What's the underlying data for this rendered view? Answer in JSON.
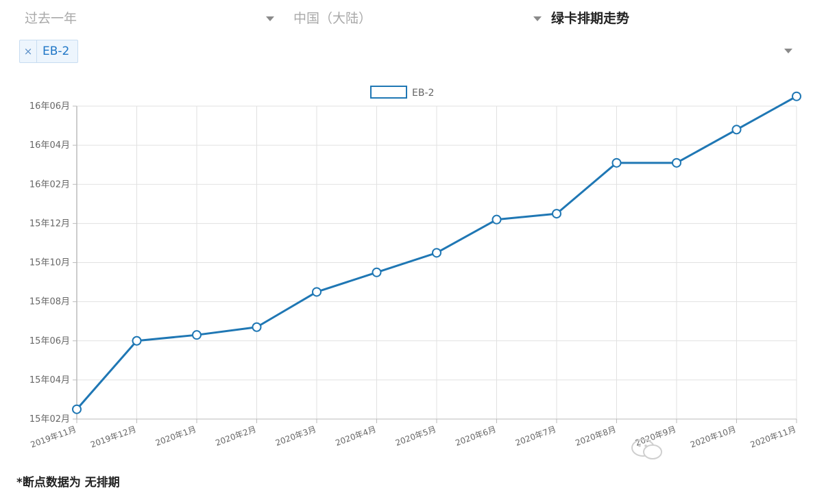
{
  "filters": {
    "time_range": {
      "value": "过去一年"
    },
    "country": {
      "value": "中国（大陆）"
    },
    "view": {
      "value": "绿卡排期走势"
    }
  },
  "selected_tags": [
    {
      "label": "EB-2"
    }
  ],
  "tag_remove_symbol": "×",
  "footnote": "*断点数据为 无排期",
  "colors": {
    "series": "#1f77b4",
    "grid": "#e1e1e1",
    "tag_text": "#1f76c6"
  },
  "chart_data": {
    "type": "line",
    "legend": {
      "position": "top-center"
    },
    "grid": true,
    "categories": [
      "2019年11月",
      "2019年12月",
      "2020年1月",
      "2020年2月",
      "2020年3月",
      "2020年4月",
      "2020年5月",
      "2020年6月",
      "2020年7月",
      "2020年8月",
      "2020年9月",
      "2020年10月",
      "2020年11月"
    ],
    "y_ticks": [
      "15年02月",
      "15年04月",
      "15年06月",
      "15年08月",
      "15年10月",
      "15年12月",
      "16年02月",
      "16年04月",
      "16年06月"
    ],
    "ylim": [
      0,
      16
    ],
    "series": [
      {
        "name": "EB-2",
        "values": [
          0.5,
          4.0,
          4.3,
          4.7,
          6.5,
          7.5,
          8.5,
          10.2,
          10.5,
          13.1,
          13.1,
          14.8,
          16.5
        ]
      }
    ]
  }
}
